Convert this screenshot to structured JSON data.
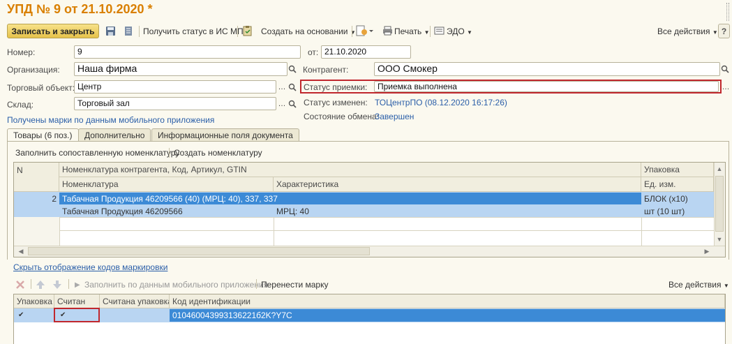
{
  "window": {
    "title": "УПД № 9 от 21.10.2020 *"
  },
  "toolbar": {
    "save_close": "Записать и закрыть",
    "get_status": "Получить статус в ИС МП",
    "create_based": "Создать на основании",
    "print": "Печать",
    "edo": "ЭДО",
    "all_actions": "Все действия"
  },
  "form": {
    "number_label": "Номер:",
    "number_value": "9",
    "date_label": "от:",
    "date_value": "21.10.2020",
    "org_label": "Организация:",
    "org_value": "Наша фирма",
    "counterparty_label": "Контрагент:",
    "counterparty_value": "ООО Смокер",
    "trade_object_label": "Торговый объект:",
    "trade_object_value": "Центр",
    "status_label": "Статус приемки:",
    "status_value": "Приемка выполнена",
    "warehouse_label": "Склад:",
    "warehouse_value": "Торговый зал",
    "status_changed_label": "Статус изменен:",
    "status_changed_value": "ТОЦентрПО (08.12.2020 16:17:26)",
    "exchange_label": "Состояние обмена:",
    "exchange_value": "Завершен",
    "mobile_link": "Получены марки по данным мобильного приложения"
  },
  "tabs": [
    {
      "label": "Товары (6 поз.)"
    },
    {
      "label": "Дополнительно"
    },
    {
      "label": "Информационные поля документа"
    }
  ],
  "goods": {
    "fill_label": "Заполнить сопоставленную номенклатуру",
    "create_label": "Создать номенклатуру",
    "headers": {
      "n": "N",
      "counterparty_nomenclature": "Номенклатура контрагента, Код, Артикул, GTIN",
      "packaging": "Упаковка",
      "nomenclature": "Номенклатура",
      "characteristic": "Характеристика",
      "unit": "Ед. изм."
    },
    "row": {
      "n": "2",
      "counterparty_nomenclature": "Табачная Продукция 46209566 (40) (МРЦ: 40), 337, 337",
      "packaging": "БЛОК (x10)",
      "nomenclature": "Табачная Продукция 46209566",
      "characteristic": "МРЦ: 40",
      "unit": "шт (10 шт)"
    }
  },
  "marks": {
    "hide_link": "Скрыть отображение кодов маркировки",
    "fill_mobile": "Заполнить по данным мобильного приложения",
    "transfer": "Перенести марку",
    "all_actions": "Все действия",
    "headers": {
      "packaging": "Упаковка",
      "scanned": "Считан",
      "scanned_packaging": "Считана упаковка",
      "code": "Код идентификации"
    },
    "row": {
      "packaging_check": "✔",
      "scanned_check": "✔",
      "scanned_packaging": "",
      "code": "010460043993136221б2K?Y7C"
    }
  },
  "colors": {
    "title": "#d97f00",
    "link": "#2a5ea8",
    "selection": "#b9d5f2",
    "selection_dark": "#3c8ad6",
    "highlight_border": "#c0272d"
  }
}
